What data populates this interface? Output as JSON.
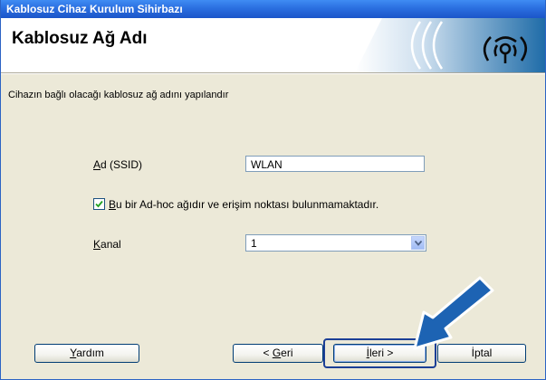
{
  "window": {
    "title": "Kablosuz Cihaz Kurulum Sihirbazı"
  },
  "header": {
    "title": "Kablosuz Ağ Adı"
  },
  "subtitle": "Cihazın bağlı olacağı kablosuz ağ adını yapılandır",
  "form": {
    "ssid": {
      "label_mnemonic": "A",
      "label_rest": "d (SSID)",
      "value": "WLAN"
    },
    "adhoc": {
      "checked": true,
      "label_mnemonic": "B",
      "label_rest": "u bir Ad-hoc ağıdır ve erişim noktası bulunmamaktadır."
    },
    "channel": {
      "label_mnemonic": "K",
      "label_rest": "anal",
      "value": "1"
    }
  },
  "buttons": {
    "help": {
      "mnemonic": "Y",
      "rest": "ardım"
    },
    "back": {
      "prefix": "< ",
      "mnemonic": "G",
      "rest": "eri"
    },
    "next": {
      "mnemonic": "İ",
      "rest": "leri >"
    },
    "cancel": {
      "label": "İptal"
    }
  },
  "icons": {
    "logo": "wireless-signal-icon",
    "annotation": "pointing-arrow-icon",
    "checkbox": "checkmark-icon",
    "dropdown": "chevron-down-icon"
  },
  "colors": {
    "titlebar": "#2b6fe0",
    "arrow": "#1d63b3",
    "highlight_ring": "#1c3f96"
  }
}
